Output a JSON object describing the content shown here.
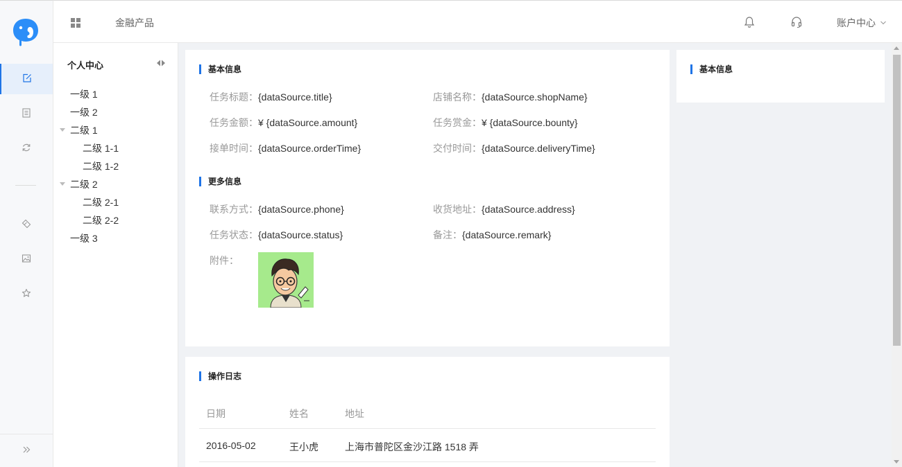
{
  "header": {
    "product_label": "金融产品",
    "account_label": "账户中心"
  },
  "rail": {
    "icons": [
      "edit-icon",
      "document-icon",
      "refresh-icon",
      "tag-icon",
      "image-icon",
      "star-icon"
    ],
    "active_index": 0,
    "expand_icon": "double-chevron-right-icon"
  },
  "tree": {
    "title": "个人中心",
    "nodes": [
      {
        "label": "一级 1",
        "level": 1
      },
      {
        "label": "一级 2",
        "level": 1
      },
      {
        "label": "二级 1",
        "level": 1,
        "expanded": true
      },
      {
        "label": "二级 1-1",
        "level": 2
      },
      {
        "label": "二级 1-2",
        "level": 2
      },
      {
        "label": "二级 2",
        "level": 1,
        "expanded": true
      },
      {
        "label": "二级 2-1",
        "level": 2
      },
      {
        "label": "二级 2-2",
        "level": 2
      },
      {
        "label": "一级 3",
        "level": 1
      }
    ]
  },
  "info": {
    "basic_title": "基本信息",
    "more_title": "更多信息",
    "fields": {
      "title": {
        "label": "任务标题：",
        "value": "{dataSource.title}"
      },
      "shop": {
        "label": "店铺名称：",
        "value": "{dataSource.shopName}"
      },
      "amount": {
        "label": "任务金额：",
        "value": "¥ {dataSource.amount}"
      },
      "bounty": {
        "label": "任务赏金：",
        "value": "¥ {dataSource.bounty}"
      },
      "order_time": {
        "label": "接单时间：",
        "value": "{dataSource.orderTime}"
      },
      "delivery_time": {
        "label": "交付时间：",
        "value": "{dataSource.deliveryTime}"
      },
      "phone": {
        "label": "联系方式：",
        "value": "{dataSource.phone}"
      },
      "address": {
        "label": "收货地址：",
        "value": "{dataSource.address}"
      },
      "status": {
        "label": "任务状态：",
        "value": "{dataSource.status}"
      },
      "remark": {
        "label": "备注：",
        "value": "{dataSource.remark}"
      },
      "attachment": {
        "label": "附件："
      }
    }
  },
  "log": {
    "title": "操作日志",
    "columns": [
      "日期",
      "姓名",
      "地址"
    ],
    "rows": [
      [
        "2016-05-02",
        "王小虎",
        "上海市普陀区金沙江路 1518 弄"
      ]
    ]
  },
  "side": {
    "title": "基本信息"
  },
  "colors": {
    "accent": "#1f74e6",
    "avatar_bg": "#a6ea8c"
  }
}
